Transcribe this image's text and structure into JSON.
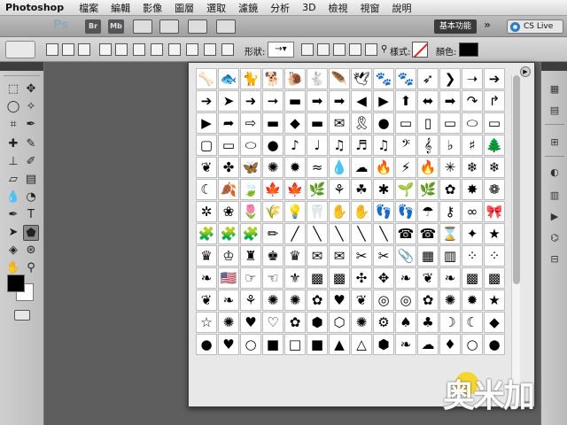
{
  "menubar": {
    "app_name": "Photoshop",
    "items": [
      "檔案",
      "編輯",
      "影像",
      "圖層",
      "選取",
      "濾鏡",
      "分析",
      "3D",
      "檢視",
      "視窗",
      "說明"
    ]
  },
  "appbar": {
    "logo": "Ps",
    "bridge": "Br",
    "minibridge": "Mb",
    "workspace": "基本功能",
    "cs_live": "CS Live"
  },
  "options": {
    "shape_label": "形狀:",
    "style_label": "樣式:",
    "color_label": "顏色:",
    "style_swatch_color": "#ffffff",
    "fill_color": "#000000"
  },
  "colors": {
    "foreground": "#000000",
    "background": "#ffffff"
  },
  "shapes": [
    "🦴",
    "🐟",
    "🐈",
    "🐕",
    "🐌",
    "🐇",
    "🪶",
    "🕊",
    "🐾",
    "🐾",
    "➶",
    "❯",
    "➝",
    "➔",
    "➔",
    "➤",
    "➜",
    "➞",
    "▬",
    "➡",
    "➡",
    "◀",
    "▶",
    "⬆",
    "⬌",
    "➡",
    "↷",
    "↱",
    "▶",
    "➦",
    "⇨",
    "▬",
    "◆",
    "▬",
    "✉",
    "🎗",
    "●",
    "▭",
    "▯",
    "▭",
    "⬭",
    "▭",
    "▢",
    "▭",
    "⬭",
    "●",
    "♪",
    "♩",
    "♫",
    "♬",
    "♫",
    "𝄢",
    "𝄞",
    "♭",
    "♯",
    "🌲",
    "❦",
    "✤",
    "🦋",
    "✺",
    "✹",
    "≈",
    "💧",
    "☁",
    "🔥",
    "⚡",
    "🔥",
    "✳",
    "❄",
    "❄",
    "☾",
    "🍂",
    "🍃",
    "🍁",
    "🍁",
    "🌿",
    "⚘",
    "☘",
    "✱",
    "🌱",
    "🌿",
    "✿",
    "✸",
    "❁",
    "✲",
    "❀",
    "🌷",
    "🌾",
    "💡",
    "🦷",
    "✋",
    "✋",
    "👣",
    "👣",
    "☂",
    "⚷",
    "∞",
    "🎀",
    "🧩",
    "🧩",
    "🧩",
    "✏",
    "╱",
    "╲",
    "╲",
    "╲",
    "╲",
    "☎",
    "☎",
    "⌛",
    "✦",
    "★",
    "♛",
    "♔",
    "♜",
    "♚",
    "♛",
    "✉",
    "✉",
    "✂",
    "✂",
    "📎",
    "▦",
    "▥",
    "⁘",
    "⁘",
    "❧",
    "🇺🇸",
    "☞",
    "☜",
    "⚜",
    "▩",
    "▩",
    "✣",
    "✥",
    "❧",
    "❦",
    "❧",
    "▩",
    "▩",
    "❦",
    "❧",
    "⚘",
    "✺",
    "✺",
    "✿",
    "♥",
    "❦",
    "◎",
    "◎",
    "✿",
    "✺",
    "✹",
    "★",
    "☆",
    "✺",
    "♥",
    "♡",
    "✿",
    "⬢",
    "⬡",
    "✺",
    "⚙",
    "♠",
    "♣",
    "☽",
    "☾",
    "◆",
    "●",
    "♥",
    "○",
    "■",
    "□",
    "■",
    "▲",
    "△",
    "⬢",
    "❧",
    "☁",
    "♦",
    "○",
    "●"
  ]
}
